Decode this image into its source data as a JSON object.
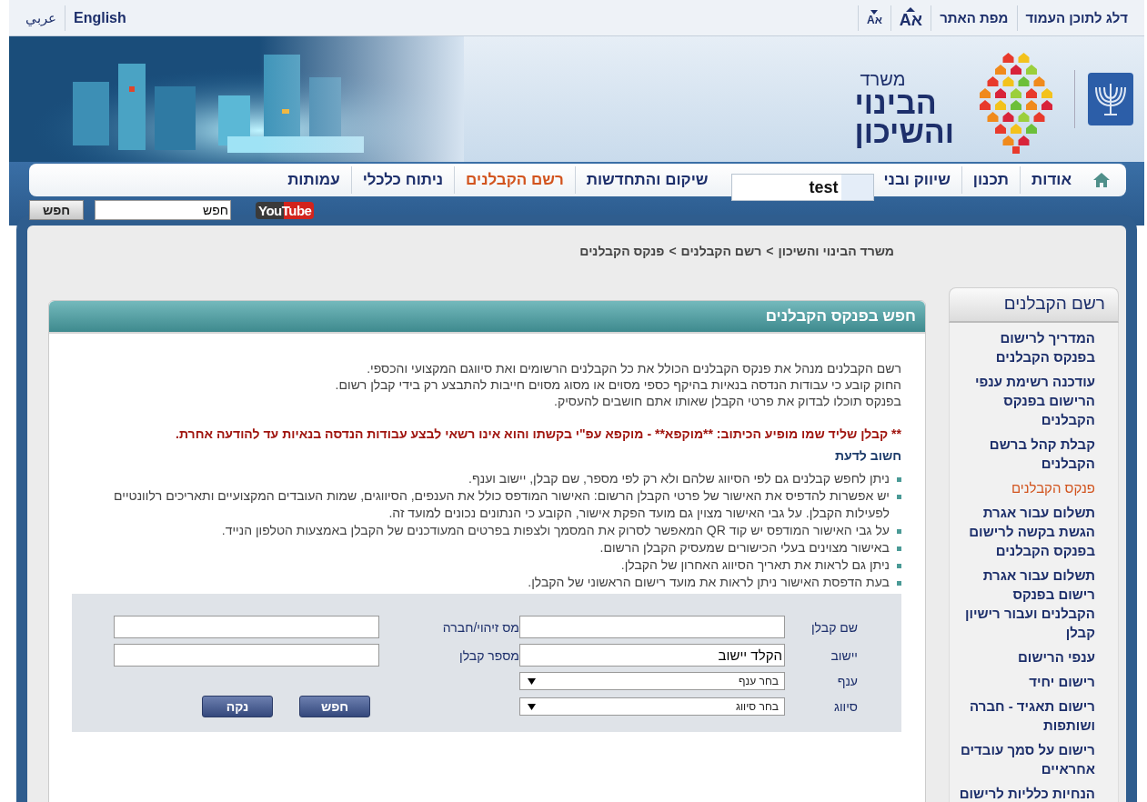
{
  "top_bar": {
    "links": [
      {
        "label": "דלג לתוכן העמוד"
      },
      {
        "label": "מפת האתר"
      }
    ],
    "font_size_controls": [
      {
        "label": "אA",
        "kind": "increase"
      },
      {
        "label": "אA",
        "kind": "decrease"
      }
    ],
    "languages": [
      {
        "label": "English"
      },
      {
        "label": "عربي"
      }
    ]
  },
  "header": {
    "ministry_label": "משרד",
    "ministry_name_lines": [
      "הבינוי",
      "והשיכון"
    ]
  },
  "nav": {
    "items": [
      {
        "kind": "home",
        "selected": false
      },
      {
        "kind": "link",
        "label": "אודות",
        "selected": false
      },
      {
        "kind": "link",
        "label": "תכנון",
        "selected": false
      },
      {
        "kind": "link",
        "label": "שיווק ובני",
        "selected": false
      },
      {
        "kind": "field",
        "label": "test",
        "selected": false
      },
      {
        "kind": "link",
        "label": "שיקום והתחדשות",
        "selected": false
      },
      {
        "kind": "link",
        "label": "רשם הקבלנים",
        "selected": true
      },
      {
        "kind": "link",
        "label": "ניתוח כלכלי",
        "selected": false
      },
      {
        "kind": "link",
        "label": "עמותות",
        "selected": false
      }
    ]
  },
  "site_search": {
    "youtube_logo": "YouTube",
    "value": "חפש",
    "button": "חפש"
  },
  "breadcrumb": {
    "items": [
      "משרד הבינוי והשיכון",
      "רשם הקבלנים",
      "פנקס הקבלנים"
    ],
    "separator": ">"
  },
  "panel": {
    "title": "חפש בפנקס הקבלנים",
    "intro": [
      "רשם הקבלנים מנהל את פנקס הקבלנים הכולל את כל הקבלנים הרשומים ואת סיווגם המקצועי והכספי.",
      "החוק קובע כי עבודות הנדסה בנאיות בהיקף כספי מסוים או מסוג מסוים חייבות להתבצע רק בידי קבלן רשום.",
      "בפנקס תוכלו לבדוק את פרטי הקבלן שאותו אתם חושבים להעסיק."
    ],
    "warning": "** קבלן שליד שמו מופיע הכיתוב: **מוקפא** - מוקפא עפ\"י בקשתו והוא אינו רשאי לבצע עבודות הנדסה בנאיות עד להודעה אחרת.",
    "important_heading": "חשוב לדעת",
    "bullets": [
      "ניתן  לחפש קבלנים גם לפי הסיווג שלהם ולא רק לפי מספר, שם קבלן, יישוב וענף.",
      "יש אפשרות להדפיס את האישור של פרטי הקבלן הרשום: האישור המודפס כולל את הענפים, הסיווגים, שמות  העובדים המקצועיים ותאריכים רלוונטיים לפעילות הקבלן. על גבי האישור מצוין גם מועד הפקת אישור, הקובע כי הנתונים נכונים למועד זה.",
      "על גבי האישור המודפס יש קוד QR המאפשר לסרוק את המסמך ולצפות בפרטים המעודכנים של הקבלן באמצעות הטלפון הנייד.",
      "באישור מצוינים בעלי הכישורים שמעסיק הקבלן הרשום.",
      "ניתן גם לראות את תאריך הסיווג האחרון של הקבלן.",
      "בעת הדפסת האישור ניתן לראות את מועד רישום הראשוני של הקבלן."
    ],
    "form": {
      "fields": [
        {
          "label": "שם קבלן",
          "kind": "input"
        },
        {
          "label": "מס זיהוי/חברה",
          "kind": "input"
        },
        {
          "label": "יישוב",
          "kind": "input",
          "value": "הקלד יישוב"
        },
        {
          "label": "מספר קבלן",
          "kind": "input"
        },
        {
          "label": "ענף",
          "kind": "select",
          "value": "בחר ענף"
        },
        {
          "label": "סיווג",
          "kind": "select",
          "value": "בחר סיווג"
        }
      ],
      "buttons": [
        "חפש",
        "נקה"
      ]
    }
  },
  "sidebar": {
    "title": "רשם הקבלנים",
    "items": [
      {
        "label": "המדריך לרישום בפנקס הקבלנים",
        "selected": false
      },
      {
        "label": "עודכנה רשימת ענפי הרישום בפנקס הקבלנים",
        "selected": false
      },
      {
        "label": "קבלת קהל ברשם הקבלנים",
        "selected": false
      },
      {
        "label": "פנקס הקבלנים",
        "selected": true
      },
      {
        "label": "תשלום עבור אגרת הגשת בקשה לרישום בפנקס הקבלנים",
        "selected": false
      },
      {
        "label": "תשלום עבור אגרת רישום בפנקס הקבלנים ועבור רישיון קבלן",
        "selected": false
      },
      {
        "label": "ענפי הרישום",
        "selected": false
      },
      {
        "label": "רישום יחיד",
        "selected": false
      },
      {
        "label": "רישום תאגיד - חברה ושותפות",
        "selected": false
      },
      {
        "label": "רישום על סמך עובדים אחראיים",
        "selected": false
      },
      {
        "label": "הנחיות כלליות לרישום",
        "selected": false
      }
    ]
  }
}
